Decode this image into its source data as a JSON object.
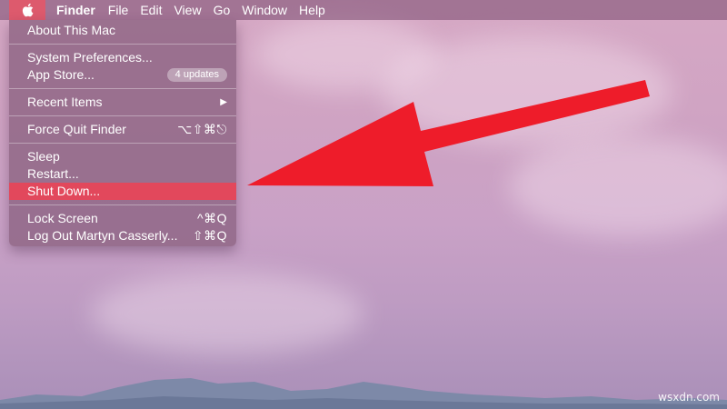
{
  "menubar": {
    "apple_icon": "apple-logo-icon",
    "items": [
      "Finder",
      "File",
      "Edit",
      "View",
      "Go",
      "Window",
      "Help"
    ]
  },
  "apple_menu": {
    "about": "About This Mac",
    "system_prefs": "System Preferences...",
    "app_store": "App Store...",
    "app_store_badge": "4 updates",
    "recent_items": "Recent Items",
    "force_quit": "Force Quit Finder",
    "force_quit_shortcut": "⌥⇧⌘⎋",
    "sleep": "Sleep",
    "restart": "Restart...",
    "shut_down": "Shut Down...",
    "lock_screen": "Lock Screen",
    "lock_screen_shortcut": "^⌘Q",
    "log_out": "Log Out Martyn Casserly...",
    "log_out_shortcut": "⇧⌘Q"
  },
  "watermark": "wsxdn.com",
  "colors": {
    "highlight": "#e2485c",
    "arrow": "#ee1c2a"
  }
}
